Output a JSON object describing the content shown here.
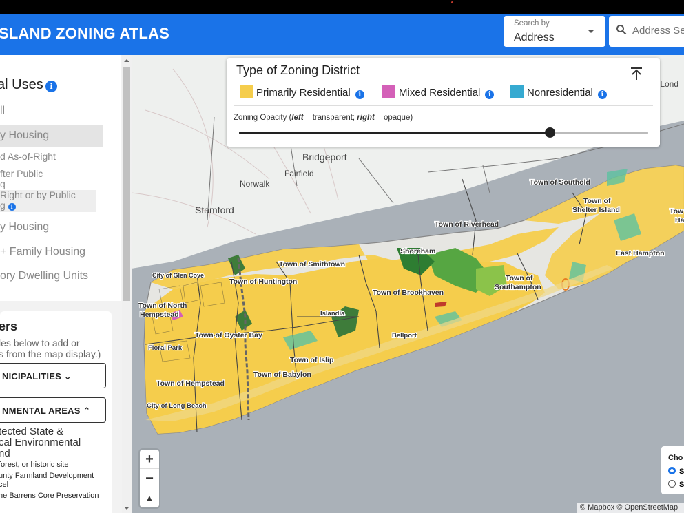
{
  "header": {
    "app_title": "SLAND ZONING ATLAS",
    "search_by_label": "Search by",
    "search_by_value": "Address",
    "address_placeholder": "Address Se"
  },
  "sidebar": {
    "uses_title": "al Uses",
    "uses": [
      "ll",
      "y Housing",
      "y Housing",
      "+ Family Housing",
      "ory Dwelling Units"
    ],
    "sub_uses": [
      "d As-of-Right",
      "fter Public",
      "q",
      "Right or by Public",
      "g"
    ],
    "layers_title": "ers",
    "layers_desc": [
      "les below to add or",
      "s from the map display.)"
    ],
    "municipalities_label": "NICIPALITIES",
    "environmental_label": "NMENTAL AREAS",
    "env_items": [
      "tected State &",
      "cal Environmental",
      "nd"
    ],
    "env_small": [
      "forest, or historic site",
      "unty Farmland Development",
      "cel",
      "ne Barrens Core Preservation"
    ]
  },
  "zoning_card": {
    "title": "Type of Zoning District",
    "legend": [
      {
        "label": "Primarily Residential",
        "color": "#f5cd4c"
      },
      {
        "label": "Mixed Residential",
        "color": "#d460b8"
      },
      {
        "label": "Nonresidential",
        "color": "#36aad1"
      }
    ],
    "opacity_prefix": "Zoning Opacity (",
    "opacity_left": "left",
    "opacity_mid": " = transparent; ",
    "opacity_right": "right",
    "opacity_suffix": " = opaque)",
    "opacity_value": 0.76
  },
  "map": {
    "labels": {
      "bridgeport": "Bridgeport",
      "fairfield": "Fairfield",
      "norwalk": "Norwalk",
      "stamford": "Stamford",
      "new_london": "v Lond",
      "southold": "Town of Southold",
      "shelter_island": "Town of",
      "shelter_island2": "Shelter Island",
      "riverhead": "Town of Riverhead",
      "east_hampton": "East Hampton",
      "east_hampton_town": "Tow",
      "east_hampton_town2": "Ha",
      "shoreham": "Shoreham",
      "smithtown": "Town of Smithtown",
      "huntington": "Town of Huntington",
      "glen_cove": "City of Glen Cove",
      "north_hempstead": "Town of North",
      "north_hempstead2": "Hempstead",
      "brookhaven": "Town of Brookhaven",
      "southampton": "Town of",
      "southampton2": "Southampton",
      "islandia": "Islandia",
      "oyster_bay": "Town of Oyster Bay",
      "floral_park": "Floral Park",
      "bellport": "Bellport",
      "islip": "Town of Islip",
      "babylon": "Town of Babylon",
      "hempstead": "Town of Hempstead",
      "long_beach": "City of Long Beach"
    },
    "zoom_in": "+",
    "zoom_out": "−",
    "compass": "▲",
    "choose_title": "Cho",
    "choose_opt1": "S",
    "choose_opt2": "S",
    "attribution": "© Mapbox © OpenStreetMap"
  }
}
